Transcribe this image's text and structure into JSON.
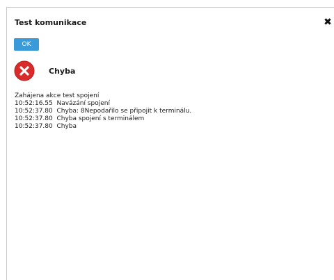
{
  "dialog": {
    "title": "Test komunikace",
    "close_icon": "close-icon",
    "ok_label": "OK",
    "status": {
      "icon": "error-icon",
      "label": "Chyba"
    },
    "log": [
      "Zahájena akce test spojení",
      "10:52:16.55  Navázání spojení",
      "10:52:37.80  Chyba: 8Nepodařilo se připojit k terminálu.",
      "10:52:37.80  Chyba spojení s terminálem",
      "10:52:37.80  Chyba"
    ]
  },
  "colors": {
    "button": "#3a9bd8",
    "error_icon": "#d92b2b"
  }
}
